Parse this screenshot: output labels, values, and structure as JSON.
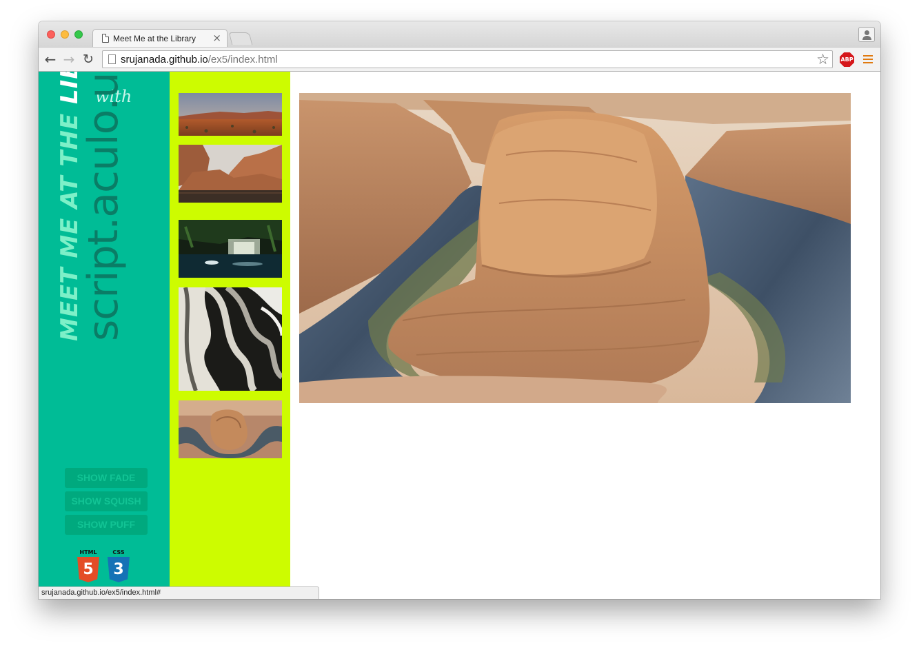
{
  "browser": {
    "tab_title": "Meet Me at the Library",
    "tab_close": "×",
    "url_host": "srujanada.github.io",
    "url_path": "/ex5/index.html",
    "status_url": "srujanada.github.io/ex5/index.html#",
    "abp_label": "ABP",
    "nav_back": "←",
    "nav_forward": "→",
    "nav_reload": "↻",
    "bookmark_star": "☆"
  },
  "sidebar": {
    "title_part1": "MEET ME AT THE ",
    "title_part2": "LIBRARY",
    "with_label": "with",
    "library_name": "script.aculo.us",
    "buttons": [
      "SHOW FADE",
      "SHOW SQUISH",
      "SHOW PUFF"
    ],
    "badges": [
      {
        "label": "HTML",
        "number": "5"
      },
      {
        "label": "CSS",
        "number": "3"
      }
    ]
  },
  "thumbnails": [
    {
      "name": "desert-landscape"
    },
    {
      "name": "canyon-river"
    },
    {
      "name": "night-waterfall-pool"
    },
    {
      "name": "antelope-canyon-waves"
    },
    {
      "name": "horseshoe-bend"
    }
  ],
  "main_image": {
    "name": "horseshoe-bend"
  },
  "colors": {
    "sidebar_bg": "#00bc96",
    "thumbs_bg": "#cdfc00",
    "button_bg": "#00a97e",
    "html5": "#e44d26",
    "css3": "#1572b6"
  }
}
